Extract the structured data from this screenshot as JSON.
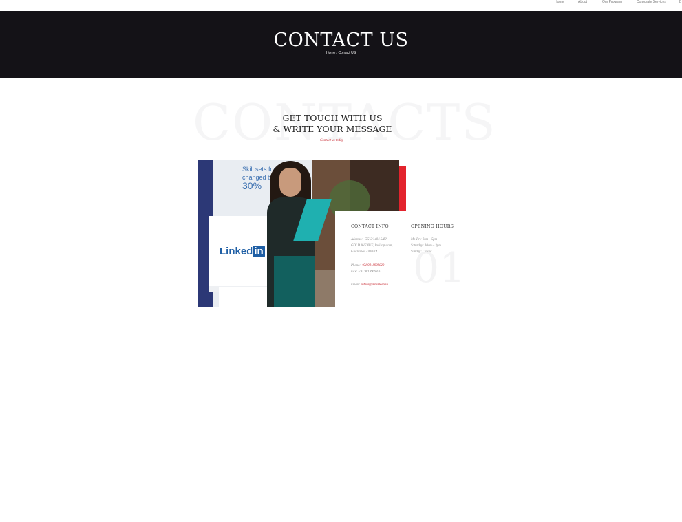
{
  "nav": {
    "items": [
      "Home",
      "About",
      "Our Program",
      "Corporate Services",
      "B"
    ]
  },
  "hero": {
    "title": "CONTACT US",
    "breadcrumb_home": "Home",
    "breadcrumb_sep": " / ",
    "breadcrumb_current": "Contact US"
  },
  "section": {
    "watermark": "CONTACTS",
    "heading_line1": "GET TOUCH WITH US",
    "heading_line2": "& WRITE YOUR MESSAGE",
    "sub_link": "Contact us today"
  },
  "photo": {
    "poster_line1": "Skill sets for jobs",
    "poster_line2": "changed by",
    "poster_big": "30%",
    "brand_text": "Linked",
    "brand_badge": "in"
  },
  "contact_info": {
    "title": "CONTACT INFO",
    "address_label": "Address:-",
    "address_line1": "GG-3/1404 SAYA",
    "address_line2": "GOLD AVENUE, Indirapuram,",
    "address_line3": "Ghaziabad -201014",
    "phone_label": "Phone:",
    "phone_value": "+91 9818909820",
    "fax_label": "Fax:",
    "fax_value": "+91 9818909820",
    "email_label": "Email:",
    "email_value": "suhini@innerleap.in"
  },
  "opening_hours": {
    "title": "OPENING HOURS",
    "line1": "Mo-Fri: 8am – 5pm",
    "line2": "Saturday: 10am – 3pm",
    "line3": "Sunday: Closed"
  },
  "card_number": "01",
  "colors": {
    "hero_bg": "#141217",
    "accent_red": "#e3232d",
    "link_red": "#c41c25"
  }
}
